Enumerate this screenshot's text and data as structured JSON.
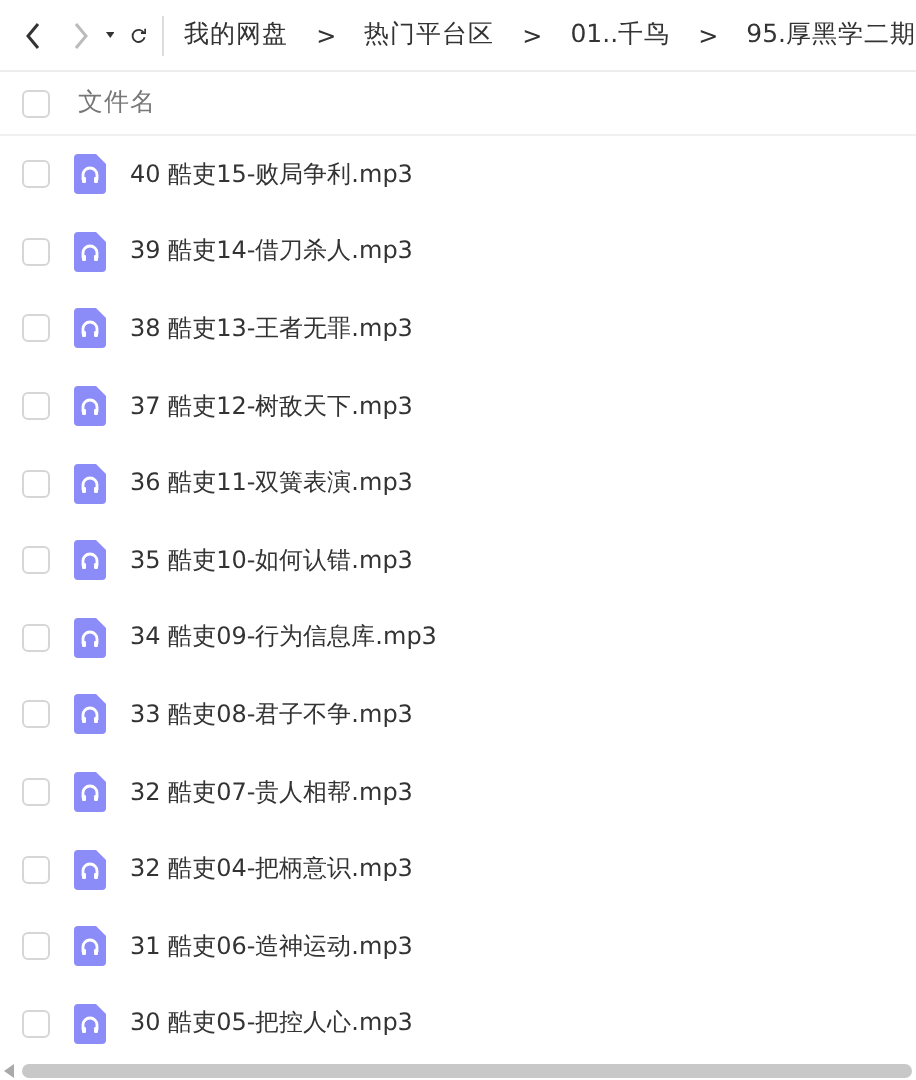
{
  "toolbar": {
    "back_enabled": true,
    "forward_enabled": false
  },
  "breadcrumb": [
    {
      "kind": "folder",
      "label": "我的网盘"
    },
    {
      "kind": "separator",
      "label": ">"
    },
    {
      "kind": "folder",
      "label": "热门平台区"
    },
    {
      "kind": "separator",
      "label": ">"
    },
    {
      "kind": "folder",
      "label": "01..千鸟"
    },
    {
      "kind": "separator",
      "label": ">"
    },
    {
      "kind": "folder",
      "label": "95.厚黑学二期"
    }
  ],
  "table": {
    "columns": [
      "文件名"
    ],
    "header_checked": false,
    "rows": [
      {
        "name": "40 酷吏15-败局争利.mp3",
        "checked": false
      },
      {
        "name": "39 酷吏14-借刀杀人.mp3",
        "checked": false
      },
      {
        "name": "38 酷吏13-王者无罪.mp3",
        "checked": false
      },
      {
        "name": "37 酷吏12-树敌天下.mp3",
        "checked": false
      },
      {
        "name": "36 酷吏11-双簧表演.mp3",
        "checked": false
      },
      {
        "name": "35 酷吏10-如何认错.mp3",
        "checked": false
      },
      {
        "name": "34 酷吏09-行为信息库.mp3",
        "checked": false
      },
      {
        "name": "33 酷吏08-君子不争.mp3",
        "checked": false
      },
      {
        "name": "32 酷吏07-贵人相帮.mp3",
        "checked": false
      },
      {
        "name": "32 酷吏04-把柄意识.mp3",
        "checked": false
      },
      {
        "name": "31 酷吏06-造神运动.mp3",
        "checked": false
      },
      {
        "name": "30 酷吏05-把控人心.mp3",
        "checked": false
      }
    ]
  }
}
